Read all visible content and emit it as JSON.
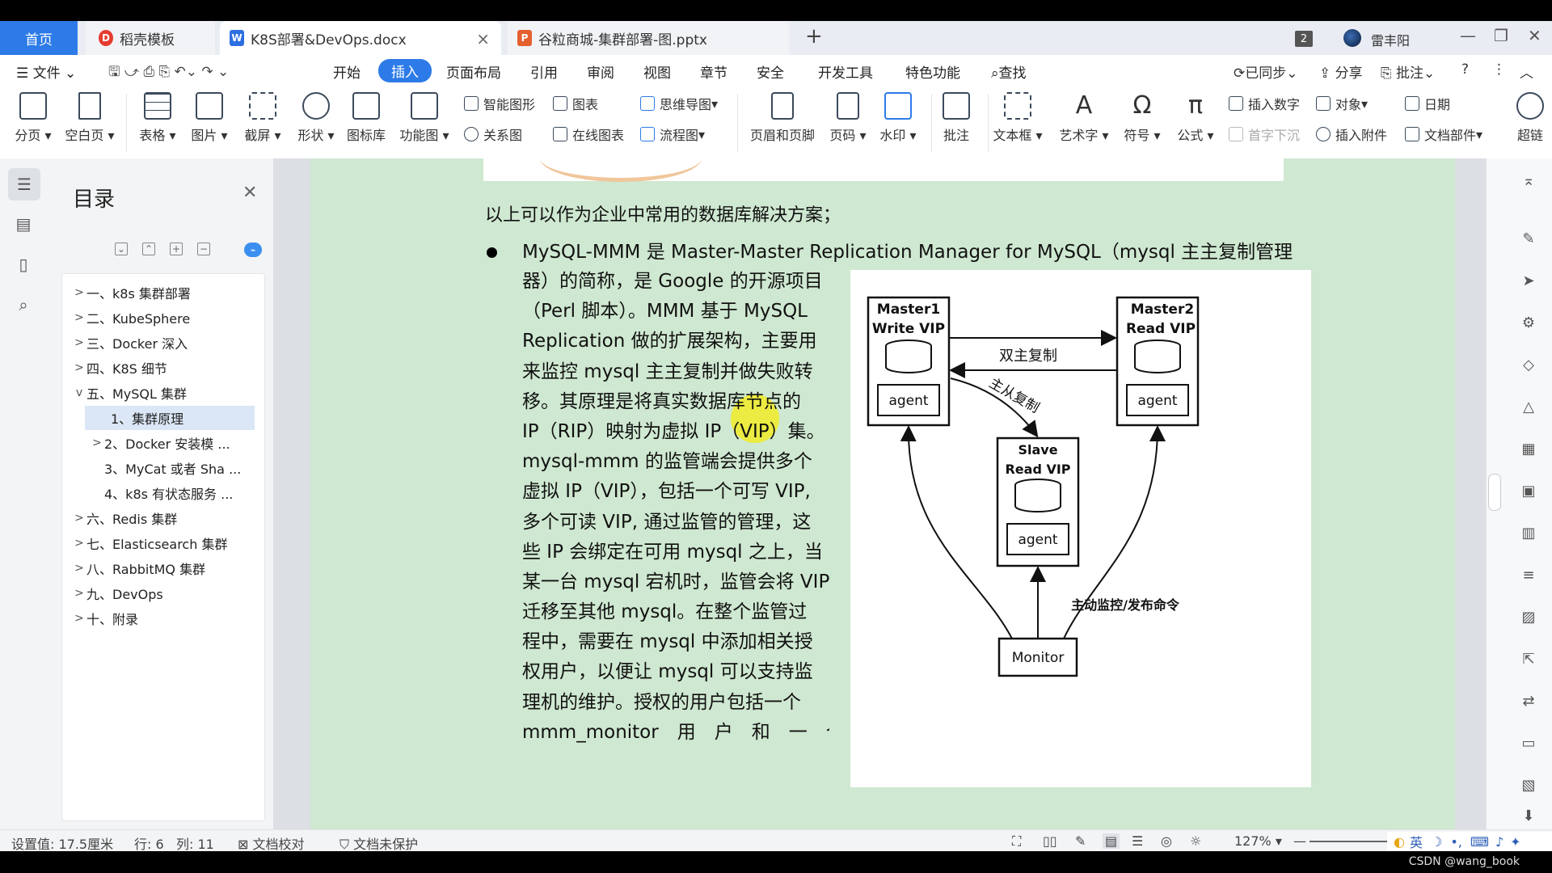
{
  "tabs": {
    "home": "首页",
    "daoke": "稻壳模板",
    "doc": "K8S部署&DevOps.docx",
    "ppt": "谷粒商城-集群部署-图.pptx",
    "count": "2",
    "user": "雷丰阳"
  },
  "menu": {
    "file": "文件",
    "items": [
      "开始",
      "插入",
      "页面布局",
      "引用",
      "审阅",
      "视图",
      "章节",
      "安全",
      "开发工具",
      "特色功能"
    ],
    "search": "查找",
    "synced": "已同步",
    "share": "分享",
    "comment": "批注"
  },
  "ribbon": {
    "big": [
      "分页",
      "空白页",
      "表格",
      "图片",
      "截屏",
      "形状",
      "图标库",
      "功能图"
    ],
    "small_col1": [
      "智能图形",
      "关系图"
    ],
    "small_col2": [
      "图表",
      "在线图表"
    ],
    "small_col3": [
      "思维导图",
      "流程图"
    ],
    "big2": [
      "页眉和页脚",
      "页码",
      "水印",
      "批注",
      "文本框",
      "艺术字",
      "符号",
      "公式"
    ],
    "small_col4": [
      "插入数字",
      "首字下沉"
    ],
    "small_col5": [
      "对象",
      "插入附件"
    ],
    "small_col6": [
      "日期",
      "文档部件"
    ],
    "last": "超链"
  },
  "toc": {
    "title": "目录",
    "items": [
      {
        "label": "一、k8s 集群部署",
        "level": 0,
        "expand": ">"
      },
      {
        "label": "二、KubeSphere",
        "level": 0,
        "expand": ">"
      },
      {
        "label": "三、Docker 深入",
        "level": 0,
        "expand": ">"
      },
      {
        "label": "四、K8S 细节",
        "level": 0,
        "expand": ">"
      },
      {
        "label": "五、MySQL 集群",
        "level": 0,
        "expand": "v"
      },
      {
        "label": "1、集群原理",
        "level": 1,
        "expand": "",
        "selected": true
      },
      {
        "label": "2、Docker 安装模 ...",
        "level": 1,
        "expand": ">"
      },
      {
        "label": "3、MyCat 或者 Sha ...",
        "level": 1,
        "expand": ""
      },
      {
        "label": "4、k8s 有状态服务 ...",
        "level": 1,
        "expand": ""
      },
      {
        "label": "六、Redis 集群",
        "level": 0,
        "expand": ">"
      },
      {
        "label": "七、Elasticsearch 集群",
        "level": 0,
        "expand": ">"
      },
      {
        "label": "八、RabbitMQ 集群",
        "level": 0,
        "expand": ">"
      },
      {
        "label": "九、DevOps",
        "level": 0,
        "expand": ">"
      },
      {
        "label": "十、附录",
        "level": 0,
        "expand": ">"
      }
    ]
  },
  "document": {
    "intro": "以上可以作为企业中常用的数据库解决方案；",
    "first_line": "MySQL-MMM 是 Master-Master Replication Manager for MySQL（mysql 主主复制管理",
    "para_lines": [
      "器）的简称，是 Google 的开源项目",
      "（Perl 脚本）。MMM 基于 MySQL",
      "Replication 做的扩展架构，主要用",
      "来监控 mysql 主主复制并做失败转",
      "移。其原理是将真实数据库节点的",
      "IP（RIP）映射为虚拟 IP（VIP）集。",
      "mysql-mmm 的监管端会提供多个",
      "虚拟 IP（VIP），包括一个可写 VIP,",
      "多个可读 VIP, 通过监管的管理，这",
      "些 IP 会绑定在可用 mysql 之上，当",
      "某一台 mysql 宕机时，监管会将 VIP",
      "迁移至其他 mysql。在整个监管过",
      "程中，需要在 mysql 中添加相关授",
      "权用户，以便让 mysql 可以支持监",
      "理机的维护。授权的用户包括一个",
      "mmm_monitor　用　户　和　一　个"
    ]
  },
  "diagram": {
    "master1_title": "Master1",
    "master1_sub": "Write VIP",
    "master2_title": "Master2",
    "master2_sub": "Read VIP",
    "slave_title": "Slave",
    "slave_sub": "Read VIP",
    "agent": "agent",
    "monitor": "Monitor",
    "dual": "双主复制",
    "master_slave": "主从复制",
    "monitor_cmd": "主动监控/发布命令"
  },
  "status": {
    "setting": "设置值: 17.5厘米",
    "row": "行: 6",
    "col": "列: 11",
    "proof": "文档校对",
    "protect": "文档未保护",
    "zoom": "127%",
    "ime": "英"
  },
  "watermark": "CSDN @wang_book"
}
